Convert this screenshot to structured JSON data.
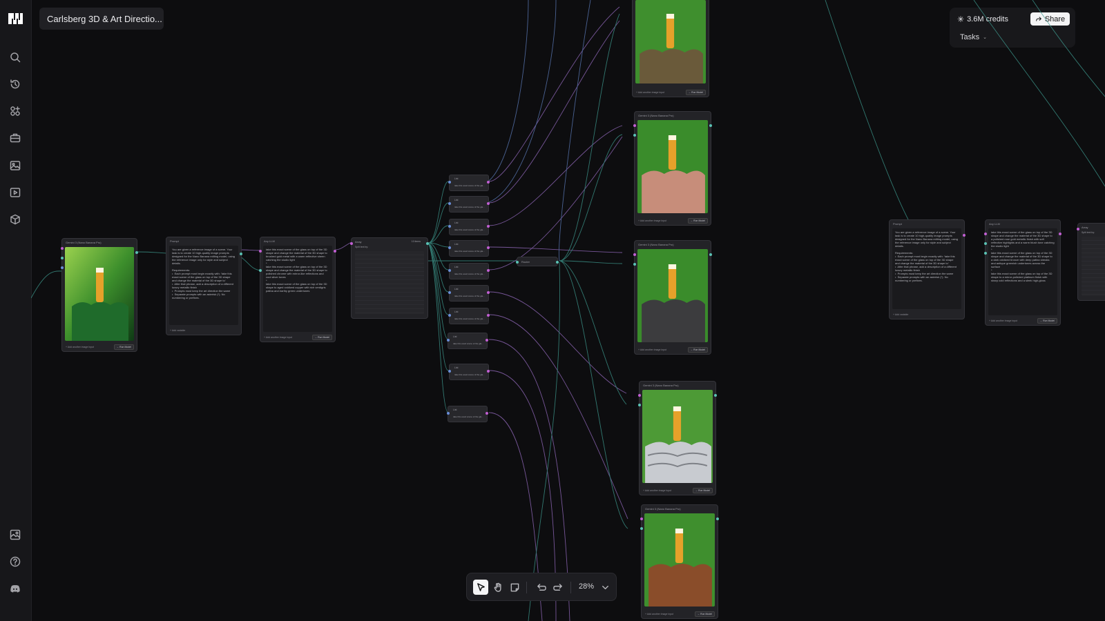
{
  "project": {
    "title": "Carlsberg 3D & Art Directio..."
  },
  "header": {
    "credits": "3.6M credits",
    "share_label": "Share",
    "tasks_label": "Tasks"
  },
  "toolbar": {
    "zoom": "28%"
  },
  "nodes": {
    "gemini_title": "Gemini 3 (Nano Banana Pro)",
    "prompt_title": "Prompt",
    "llm_title": "Any LLM",
    "array_title": "Array",
    "list_title": "List",
    "router_title": "Router",
    "add_image_input": "+ Add another image input",
    "run_model": "→ Run Model",
    "add_variable": "+ Add variable",
    "array_split": "Split text by:",
    "array_items": "10 items",
    "list_text": "take this exact scene of the gla...",
    "prompt_text": "You are given a reference image of a scene. Your task is to create 10 high-quality image prompts designed for the Nano Banana editing model, using the reference image only for style and subject details.\n\nRequirements:\n•  Each prompt must begin exactly with: 'take this exact scene of the glass on top of the 3D shape and change the material of the 3D shape to'\n•  After that phrase, add a description of a different luxury metallic finish\n•  Prompts must keep the art direction the same\n•  Separate prompts with an asterisk (*). No numbering or prefixes.",
    "llm_text": "take this exact scene of the glass on top of the 3D shape and change the material of the 3D shape to brushed gold metal with a warm reflective sheen catching the studio light\n*\ntake this exact scene of the glass on top of the 3D shape and change the material of the 3D shape to polished chrome with mirror-like reflections and cool silver tones\n*\ntake this exact scene of the glass on top of the 3D shape to aged oxidized copper with rich verdigris patina and earthy green undertones",
    "llm_text_2": "take this exact scene of the glass on top of the 3D shape and change the material of the 3D shape to a polished rose gold metallic finish with soft reflective highlights and a warm blush tone catching the studio light\n*\ntake this exact scene of the glass on top of the 3D shape and change the material of the 3D shape to a dark oxidized bronze with deep patina streaks and antique greenish undertones across the surface\n*\ntake this exact scene of the glass on top of the 3D shape to a mirror-polished platinum finish with sharp cold reflections and a sleek high-gloss"
  },
  "colors": {
    "wire_purple": "#9b6fc7",
    "wire_teal": "#3f9d92",
    "wire_blue": "#5f7fc0",
    "canvas_bg": "#0d0d0f"
  }
}
